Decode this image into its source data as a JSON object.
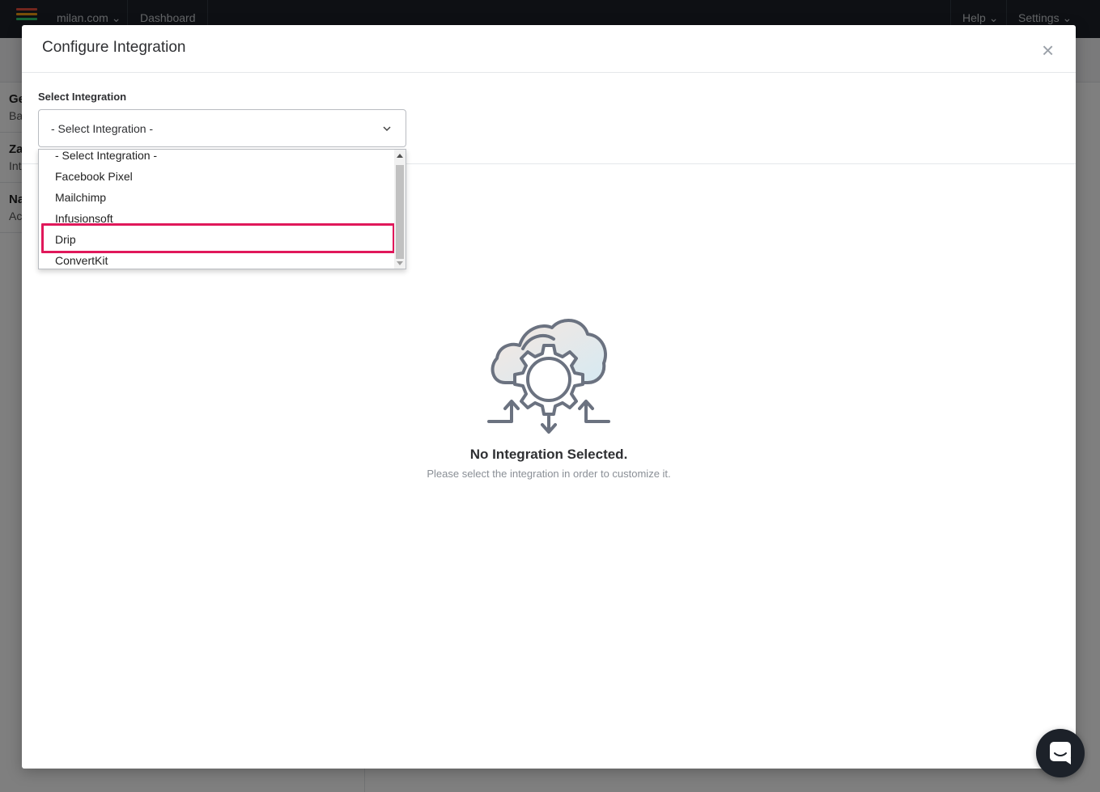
{
  "topbar": {
    "site": "milan.com",
    "dashboard": "Dashboard",
    "help": "Help",
    "settings": "Settings"
  },
  "sidebar": {
    "items": [
      {
        "title": "Ge",
        "subtitle": "Ba"
      },
      {
        "title": "Za",
        "subtitle": "Int"
      },
      {
        "title": "Na",
        "subtitle": "Ac"
      }
    ]
  },
  "modal": {
    "title": "Configure Integration",
    "close": "×",
    "select_label": "Select Integration",
    "select_value": "- Select Integration -",
    "options": [
      "- Select Integration -",
      "Facebook Pixel",
      "Mailchimp",
      "Infusionsoft",
      "Drip",
      "ConvertKit"
    ],
    "highlighted_option": "Drip",
    "empty_title": "No Integration Selected.",
    "empty_subtitle": "Please select the integration in order to customize it."
  },
  "colors": {
    "highlight": "#e0185a",
    "topbar": "#1c2129"
  },
  "icons": {
    "close": "close-icon",
    "chevron": "chevron-down-icon",
    "empty": "cloud-gear-icon",
    "chat": "chat-icon"
  }
}
